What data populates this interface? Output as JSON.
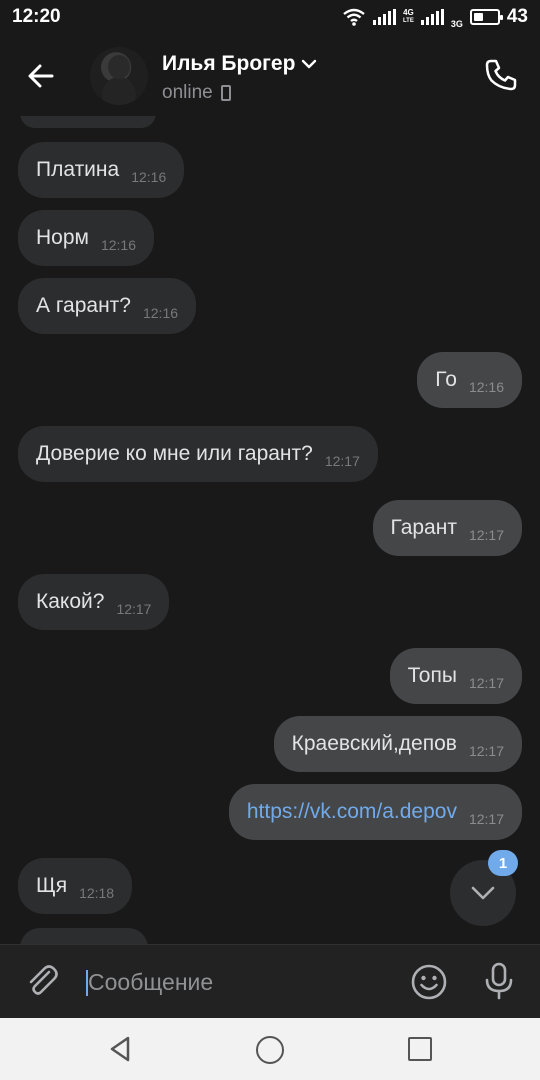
{
  "status_bar": {
    "time": "12:20",
    "net1_top": "4G",
    "net1_bottom": "LTE",
    "net2": "3G",
    "battery": "43"
  },
  "header": {
    "contact_name": "Илья Брогер",
    "status": "online",
    "icons": {
      "back": "arrow-left-icon",
      "call": "phone-icon",
      "device": "mobile-icon",
      "expand": "chevron-down-icon"
    }
  },
  "messages": [
    {
      "dir": "in",
      "text": "Платина",
      "time": "12:16"
    },
    {
      "dir": "in",
      "text": "Норм",
      "time": "12:16"
    },
    {
      "dir": "in",
      "text": "А гарант?",
      "time": "12:16"
    },
    {
      "dir": "out",
      "text": "Го",
      "time": "12:16"
    },
    {
      "dir": "in",
      "text": "Доверие ко мне или гарант?",
      "time": "12:17"
    },
    {
      "dir": "out",
      "text": "Гарант",
      "time": "12:17"
    },
    {
      "dir": "in",
      "text": "Какой?",
      "time": "12:17"
    },
    {
      "dir": "out",
      "text": "Топы",
      "time": "12:17"
    },
    {
      "dir": "out",
      "text": "Краевский,депов",
      "time": "12:17"
    },
    {
      "dir": "out",
      "text": "https://vk.com/a.depov",
      "time": "12:17",
      "is_link": true
    },
    {
      "dir": "in",
      "text": "Щя",
      "time": "12:18"
    }
  ],
  "scroll_down": {
    "unread_count": "1"
  },
  "composer": {
    "placeholder": "Сообщение",
    "icons": {
      "attach": "paperclip-icon",
      "emoji": "smile-icon",
      "voice": "microphone-icon"
    }
  },
  "colors": {
    "background": "#19191a",
    "incoming_bubble": "#2c2d2e",
    "outgoing_bubble": "#454647",
    "accent": "#71aaeb",
    "nav_bar": "#f2f2f2"
  }
}
